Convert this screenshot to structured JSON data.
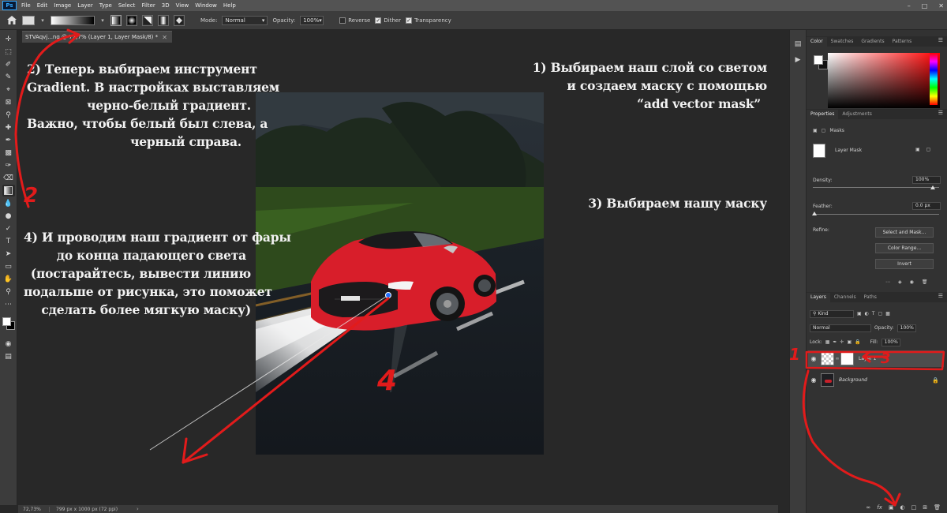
{
  "menubar": {
    "logo": "Ps",
    "items": [
      "File",
      "Edit",
      "Image",
      "Layer",
      "Type",
      "Select",
      "Filter",
      "3D",
      "View",
      "Window",
      "Help"
    ]
  },
  "options": {
    "mode_label": "Mode:",
    "mode_value": "Normal",
    "opacity_label": "Opacity:",
    "opacity_value": "100%",
    "reverse_label": "Reverse",
    "dither_label": "Dither",
    "transparency_label": "Transparency"
  },
  "document": {
    "tab_title": "STVAqvj...ng @ 72,7% (Layer 1, Layer Mask/8) *",
    "zoom": "72,73%",
    "doc_info": "799 px x 1000 px (72 ppi)"
  },
  "annotations": {
    "step2": [
      "2) Теперь выбираем инструмент",
      "Gradient. В настройках выставляем",
      "черно-белый градиент.",
      "Важно, чтобы белый был слева, а",
      "черный справа."
    ],
    "step1": [
      "1) Выбираем наш слой со светом",
      "и создаем маску с помощью",
      "“add vector mask”"
    ],
    "step3": [
      "3) Выбираем нашу маску"
    ],
    "step4": [
      "4) И проводим наш градиент от фары",
      "до конца падающего света",
      "(постарайтесь, вывести линию",
      "подальше от рисунка, это поможет",
      "сделать более мягкую маску)"
    ],
    "marks": {
      "m1": "1",
      "m2": "2",
      "m3": "3",
      "m4": "4"
    }
  },
  "color_panel": {
    "tabs": [
      "Color",
      "Swatches",
      "Gradients",
      "Patterns"
    ]
  },
  "properties": {
    "tabs": [
      "Properties",
      "Adjustments"
    ],
    "masks_label": "Masks",
    "layer_mask_label": "Layer Mask",
    "density_label": "Density:",
    "density_value": "100%",
    "feather_label": "Feather:",
    "feather_value": "0.0 px",
    "refine_label": "Refine:",
    "select_mask_label": "Select and Mask...",
    "color_range_label": "Color Range...",
    "invert_label": "Invert"
  },
  "layers": {
    "tabs": [
      "Layers",
      "Channels",
      "Paths"
    ],
    "kind_label": "Kind",
    "blend_value": "Normal",
    "opacity_label": "Opacity:",
    "opacity_value": "100%",
    "lock_label": "Lock:",
    "fill_label": "Fill:",
    "fill_value": "100%",
    "items": [
      {
        "name": "Layer 1"
      },
      {
        "name": "Background"
      }
    ],
    "footer_fx": "fx"
  }
}
